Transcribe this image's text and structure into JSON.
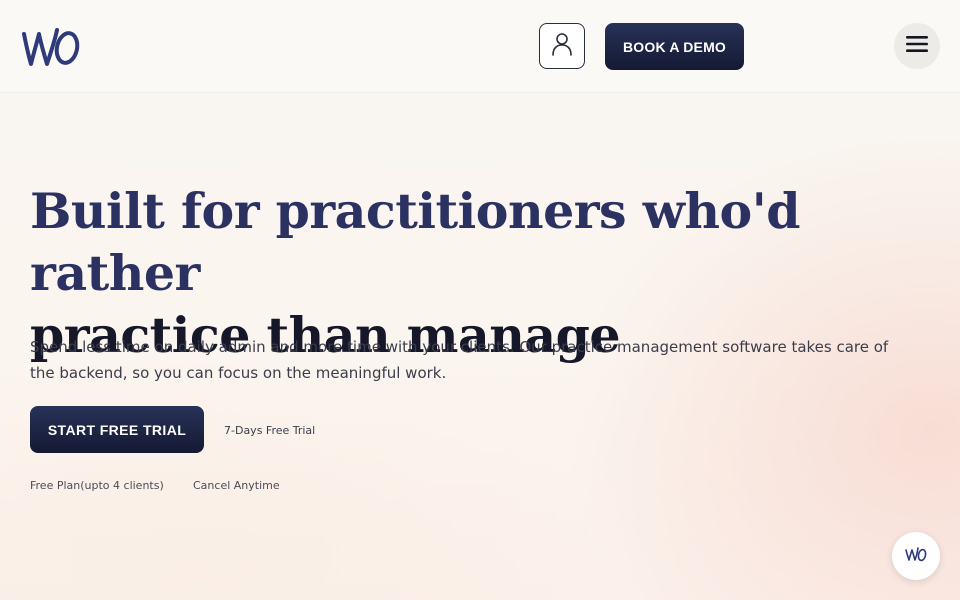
{
  "header": {
    "logo_icon": "wo-logo-icon",
    "user_icon": "user-icon",
    "book_demo_label": "BOOK A DEMO",
    "menu_icon": "hamburger-menu-icon"
  },
  "hero": {
    "title_line1": "Built for practitioners who'd rather",
    "title_line2": "practice than manage",
    "description": "Spend less time on daily admin and more time with your clients. Our practice management software takes care of the backend, so you can focus on the meaningful work.",
    "cta_label": "START FREE TRIAL",
    "trial_note": "7-Days Free Trial",
    "perks": [
      "Free Plan(upto 4 clients)",
      "Cancel Anytime"
    ]
  },
  "chat_widget": {
    "icon": "wo-chat-icon"
  },
  "colors": {
    "brand_navy": "#1e2448",
    "title_blue": "#2b3160",
    "background": "#fbf6f1",
    "accent_blush": "#f6d6cc"
  }
}
